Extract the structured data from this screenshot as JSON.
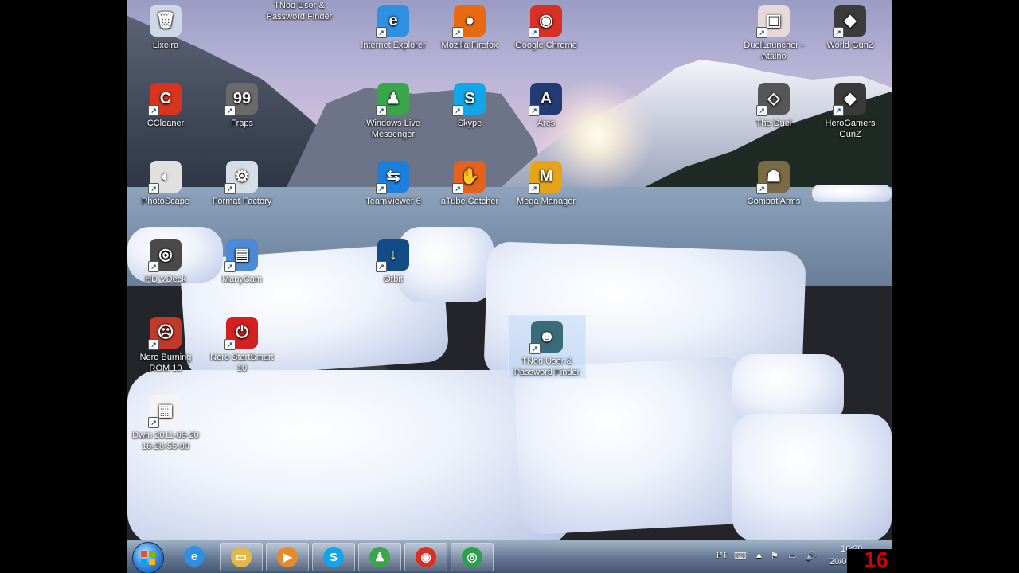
{
  "desktop_icons": [
    {
      "id": "recycle",
      "label": "Lixeira",
      "icon": "recycle-bin-icon",
      "color": "#cfd8e6",
      "glyph": "🗑"
    },
    {
      "id": "tnod_top",
      "label": "TNod User & Password Finder",
      "icon": "tnod-icon",
      "color": "#3a6b7a",
      "glyph": "☻"
    },
    {
      "id": "ie",
      "label": "Internet Explorer",
      "icon": "internet-explorer-icon",
      "color": "#2f8fe0",
      "glyph": "e"
    },
    {
      "id": "firefox",
      "label": "Mozilla Firefox",
      "icon": "firefox-icon",
      "color": "#e76a12",
      "glyph": "●"
    },
    {
      "id": "chrome",
      "label": "Google Chrome",
      "icon": "chrome-icon",
      "color": "#d93025",
      "glyph": "◉"
    },
    {
      "id": "duel_launcher",
      "label": "DuelLauncher - Atalho",
      "icon": "duel-launcher-icon",
      "color": "#e7d9d9",
      "glyph": "▣"
    },
    {
      "id": "world_gunz",
      "label": "World GunZ",
      "icon": "world-gunz-icon",
      "color": "#3b3b3b",
      "glyph": "◆"
    },
    {
      "id": "ccleaner",
      "label": "CCleaner",
      "icon": "ccleaner-icon",
      "color": "#d8341e",
      "glyph": "C"
    },
    {
      "id": "fraps",
      "label": "Fraps",
      "icon": "fraps-icon",
      "color": "#6a6a6a",
      "glyph": "99"
    },
    {
      "id": "wlm",
      "label": "Windows Live Messenger",
      "icon": "messenger-icon",
      "color": "#3aa64a",
      "glyph": "♟"
    },
    {
      "id": "skype",
      "label": "Skype",
      "icon": "skype-icon",
      "color": "#12a5e8",
      "glyph": "S"
    },
    {
      "id": "ares",
      "label": "Ares",
      "icon": "ares-icon",
      "color": "#233b73",
      "glyph": "A"
    },
    {
      "id": "the_duel",
      "label": "The Duel",
      "icon": "the-duel-icon",
      "color": "#565656",
      "glyph": "◇"
    },
    {
      "id": "herogamers",
      "label": "HeroGamers GunZ",
      "icon": "herogamers-gunz-icon",
      "color": "#3a3a3a",
      "glyph": "◆"
    },
    {
      "id": "photoscape",
      "label": "PhotoScape",
      "icon": "photoscape-icon",
      "color": "#e0e0e0",
      "glyph": "◐"
    },
    {
      "id": "format_factory",
      "label": "Format Factory",
      "icon": "format-factory-icon",
      "color": "#d7dde6",
      "glyph": "⚙"
    },
    {
      "id": "teamviewer",
      "label": "TeamViewer 6",
      "icon": "teamviewer-icon",
      "color": "#1c7fdc",
      "glyph": "⇆"
    },
    {
      "id": "atube",
      "label": "aTube Catcher",
      "icon": "atube-catcher-icon",
      "color": "#e4621e",
      "glyph": "✋"
    },
    {
      "id": "mega",
      "label": "Mega Manager",
      "icon": "mega-manager-icon",
      "color": "#e6a41b",
      "glyph": "M"
    },
    {
      "id": "combat_arms",
      "label": "Combat Arms",
      "icon": "combat-arms-icon",
      "color": "#7a6a45",
      "glyph": "☗"
    },
    {
      "id": "hdvdeck",
      "label": "HD VDeck",
      "icon": "hd-vdeck-icon",
      "color": "#4a4a4a",
      "glyph": "◎"
    },
    {
      "id": "manycam",
      "label": "ManyCam",
      "icon": "manycam-icon",
      "color": "#4c89d6",
      "glyph": "▤"
    },
    {
      "id": "orbit",
      "label": "Orbit",
      "icon": "orbit-icon",
      "color": "#114c86",
      "glyph": "↓"
    },
    {
      "id": "nero",
      "label": "Nero Burning ROM 10",
      "icon": "nero-burning-rom-icon",
      "color": "#c0392b",
      "glyph": "☹"
    },
    {
      "id": "nero_smart",
      "label": "Nero StartSmart 10",
      "icon": "nero-startsmart-icon",
      "color": "#d32020",
      "glyph": "⏻"
    },
    {
      "id": "tnod_sel",
      "label": "TNod User & Password Finder",
      "icon": "tnod-icon",
      "color": "#3a6b7a",
      "glyph": "☻"
    },
    {
      "id": "dwm",
      "label": "Dwm 2011-06-20 16-28-55-90",
      "icon": "avi-file-icon",
      "color": "#f4f4f4",
      "glyph": "▦"
    }
  ],
  "taskbar": {
    "buttons": [
      {
        "id": "ie",
        "icon": "internet-explorer-icon",
        "color": "#2f8fe0",
        "glyph": "e"
      },
      {
        "id": "explorer",
        "icon": "folder-icon",
        "color": "#e2b84a",
        "glyph": "▭"
      },
      {
        "id": "media",
        "icon": "media-player-icon",
        "color": "#e8892b",
        "glyph": "▶"
      },
      {
        "id": "skype",
        "icon": "skype-icon",
        "color": "#12a5e8",
        "glyph": "S"
      },
      {
        "id": "messenger",
        "icon": "messenger-icon",
        "color": "#3aa64a",
        "glyph": "♟"
      },
      {
        "id": "chrome",
        "icon": "chrome-icon",
        "color": "#d93025",
        "glyph": "◉"
      },
      {
        "id": "orbit",
        "icon": "orbit-icon",
        "color": "#2aa04a",
        "glyph": "◎"
      }
    ],
    "tray": {
      "language": "PT",
      "time": "16:28",
      "date": "20/06/2011"
    }
  },
  "overlay": {
    "counter": "16"
  }
}
